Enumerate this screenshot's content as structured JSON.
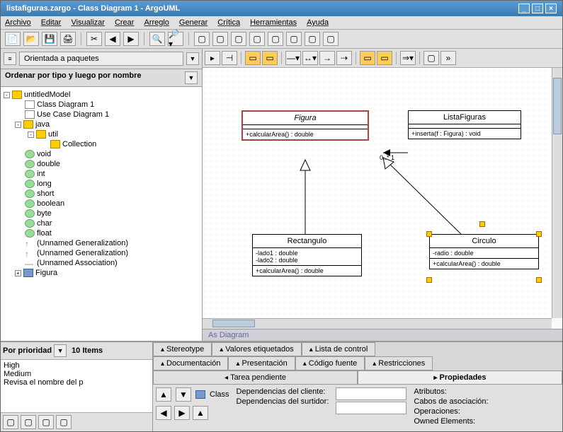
{
  "window": {
    "title": "listafiguras.zargo - Class Diagram 1 - ArgoUML"
  },
  "menu": [
    "Archivo",
    "Editar",
    "Visualizar",
    "Crear",
    "Arreglo",
    "Generar",
    "Crítica",
    "Herramientas",
    "Ayuda"
  ],
  "perspective": "Orientada a paquetes",
  "sort": "Ordenar por tipo y luego por nombre",
  "tree": {
    "root": "untitledModel",
    "items": [
      {
        "icon": "doc",
        "label": "Class Diagram 1",
        "indent": 1
      },
      {
        "icon": "doc",
        "label": "Use Case Diagram 1",
        "indent": 1
      },
      {
        "icon": "folder",
        "label": "java",
        "indent": 1,
        "toggle": "-"
      },
      {
        "icon": "folder",
        "label": "util",
        "indent": 2,
        "toggle": "-"
      },
      {
        "icon": "folder",
        "label": "Collection",
        "indent": 3
      },
      {
        "icon": "diamond",
        "label": "void",
        "indent": 1
      },
      {
        "icon": "diamond",
        "label": "double",
        "indent": 1
      },
      {
        "icon": "diamond",
        "label": "int",
        "indent": 1
      },
      {
        "icon": "diamond",
        "label": "long",
        "indent": 1
      },
      {
        "icon": "diamond",
        "label": "short",
        "indent": 1
      },
      {
        "icon": "diamond",
        "label": "boolean",
        "indent": 1
      },
      {
        "icon": "diamond",
        "label": "byte",
        "indent": 1
      },
      {
        "icon": "diamond",
        "label": "char",
        "indent": 1
      },
      {
        "icon": "diamond",
        "label": "float",
        "indent": 1
      },
      {
        "icon": "arrow",
        "label": "(Unnamed Generalization)",
        "indent": 1
      },
      {
        "icon": "arrow",
        "label": "(Unnamed Generalization)",
        "indent": 1
      },
      {
        "icon": "line",
        "label": "(Unnamed Association)",
        "indent": 1
      },
      {
        "icon": "blue",
        "label": "Figura",
        "indent": 1,
        "toggle": "+"
      }
    ]
  },
  "diagram": {
    "classes": {
      "figura": {
        "name": "Figura",
        "ops": "+calcularArea() : double",
        "italic": true,
        "selected": true
      },
      "lista": {
        "name": "ListaFiguras",
        "ops": "+inserta(f : Figura) : void"
      },
      "rect": {
        "name": "Rectangulo",
        "attrs": "-lado1 : double\n-lado2 : double",
        "ops": "+calcularArea() : double"
      },
      "circ": {
        "name": "Circulo",
        "attrs": "-radio : double",
        "ops": "+calcularArea() : double"
      }
    },
    "multiplicity": "0..* 1",
    "tab": "As Diagram"
  },
  "todo": {
    "filter": "Por prioridad",
    "count": "10 Items",
    "items": [
      "High",
      "Medium",
      "Revisa el nombre del p"
    ]
  },
  "tabs": {
    "row1": [
      "Stereotype",
      "Valores etiquetados",
      "Lista de control"
    ],
    "row2": [
      "Documentación",
      "Presentación",
      "Código fuente",
      "Restricciones"
    ],
    "row3": [
      "Tarea pendiente",
      "Propiedades"
    ]
  },
  "props": {
    "kind": "Class",
    "deps_client": "Dependencias del cliente:",
    "deps_supplier": "Dependencias del surtidor:",
    "right_labels": [
      "Atributos:",
      "Cabos de asociación:",
      "Operaciones:",
      "Owned Elements:"
    ]
  }
}
